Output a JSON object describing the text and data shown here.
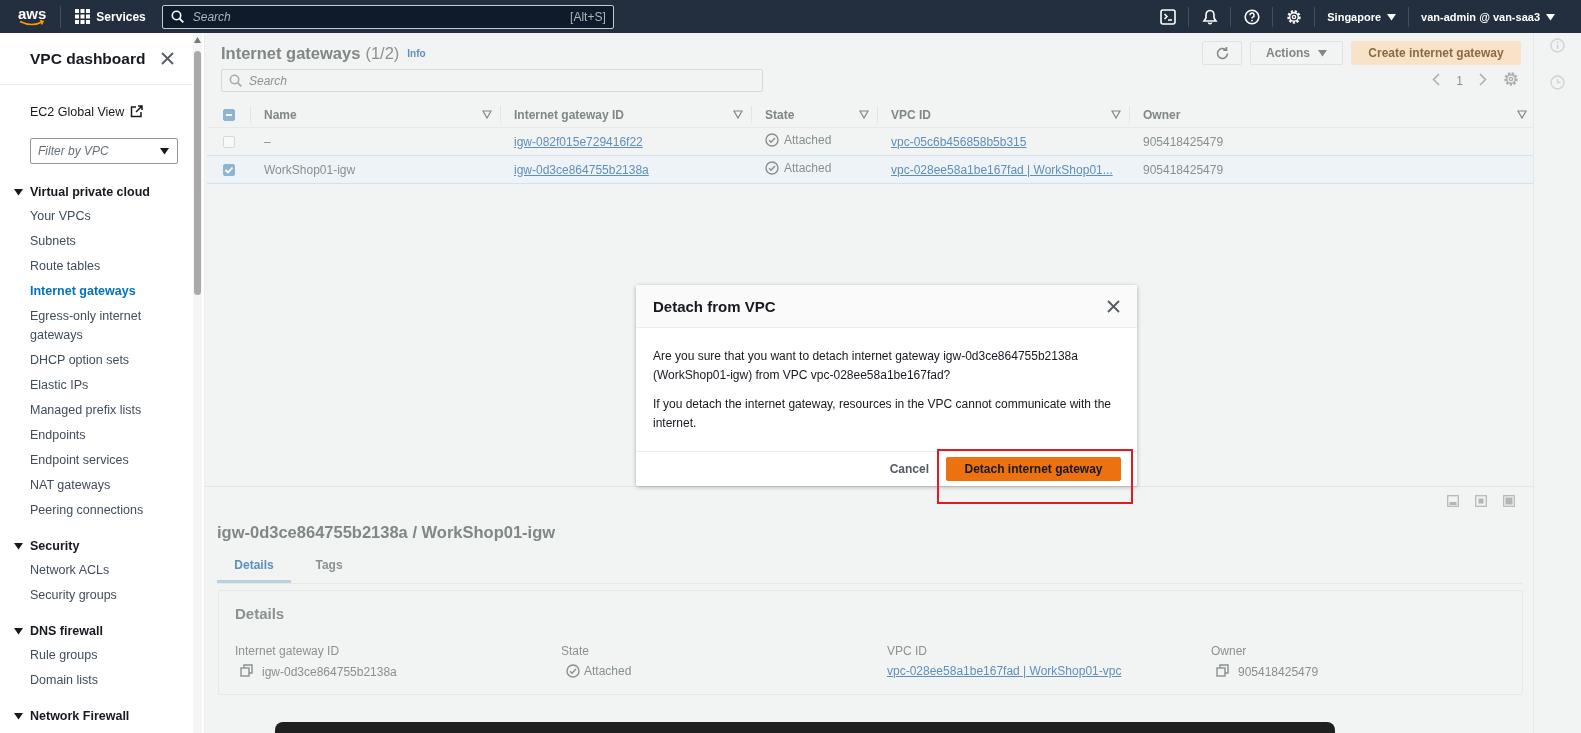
{
  "top_nav": {
    "logo": "aws",
    "services": "Services",
    "search": {
      "placeholder": "Search",
      "shortcut": "[Alt+S]"
    },
    "region": "Singapore",
    "account": "van-admin @ van-saa3"
  },
  "sidebar": {
    "title": "VPC dashboard",
    "global_view": "EC2 Global View",
    "filter": {
      "placeholder": "Filter by VPC"
    },
    "sections": [
      {
        "title": "Virtual private cloud",
        "expanded": true,
        "items": [
          {
            "label": "Your VPCs",
            "selected": false
          },
          {
            "label": "Subnets",
            "selected": false
          },
          {
            "label": "Route tables",
            "selected": false
          },
          {
            "label": "Internet gateways",
            "selected": true
          },
          {
            "label": "Egress-only internet gateways",
            "selected": false
          },
          {
            "label": "DHCP option sets",
            "selected": false
          },
          {
            "label": "Elastic IPs",
            "selected": false
          },
          {
            "label": "Managed prefix lists",
            "selected": false
          },
          {
            "label": "Endpoints",
            "selected": false
          },
          {
            "label": "Endpoint services",
            "selected": false
          },
          {
            "label": "NAT gateways",
            "selected": false
          },
          {
            "label": "Peering connections",
            "selected": false
          }
        ]
      },
      {
        "title": "Security",
        "expanded": true,
        "items": [
          {
            "label": "Network ACLs",
            "selected": false
          },
          {
            "label": "Security groups",
            "selected": false
          }
        ]
      },
      {
        "title": "DNS firewall",
        "expanded": true,
        "items": [
          {
            "label": "Rule groups",
            "selected": false
          },
          {
            "label": "Domain lists",
            "selected": false
          }
        ]
      },
      {
        "title": "Network Firewall",
        "expanded": true
      }
    ]
  },
  "table": {
    "title": "Internet gateways",
    "count": "(1/2)",
    "info": "Info",
    "actions": "Actions",
    "create": "Create internet gateway",
    "search": {
      "placeholder": "Search"
    },
    "page": "1",
    "select_all_partial": true,
    "columns": [
      "Name",
      "Internet gateway ID",
      "State",
      "VPC ID",
      "Owner"
    ],
    "rows": [
      {
        "selected": false,
        "name": "–",
        "gateway_id": "igw-082f015e729416f22",
        "state": "Attached",
        "vpc_id": "vpc-05c6b456858b5b315",
        "owner": "905418425479"
      },
      {
        "selected": true,
        "name": "WorkShop01-igw",
        "gateway_id": "igw-0d3ce864755b2138a",
        "state": "Attached",
        "vpc_id": "vpc-028ee58a1be167fad | WorkShop01...",
        "owner": "905418425479"
      }
    ]
  },
  "details": {
    "title": "igw-0d3ce864755b2138a / WorkShop01-igw",
    "tabs": [
      {
        "label": "Details",
        "selected": true
      },
      {
        "label": "Tags",
        "selected": false
      }
    ],
    "heading": "Details",
    "fields": [
      {
        "kind": "copy",
        "label": "Internet gateway ID",
        "value": "igw-0d3ce864755b2138a"
      },
      {
        "kind": "status",
        "label": "State",
        "value": "Attached"
      },
      {
        "kind": "link",
        "label": "VPC ID",
        "value": "vpc-028ee58a1be167fad | WorkShop01-vpc"
      },
      {
        "kind": "copy",
        "label": "Owner",
        "value": "905418425479"
      }
    ]
  },
  "modal": {
    "title": "Detach from VPC",
    "paragraphs": [
      "Are you sure that you want to detach internet gateway igw-0d3ce864755b2138a (WorkShop01-igw) from VPC vpc-028ee58a1be167fad?",
      "If you detach the internet gateway, resources in the VPC cannot communicate with the internet."
    ],
    "cancel": "Cancel",
    "confirm": "Detach internet gateway",
    "highlighted": true
  }
}
